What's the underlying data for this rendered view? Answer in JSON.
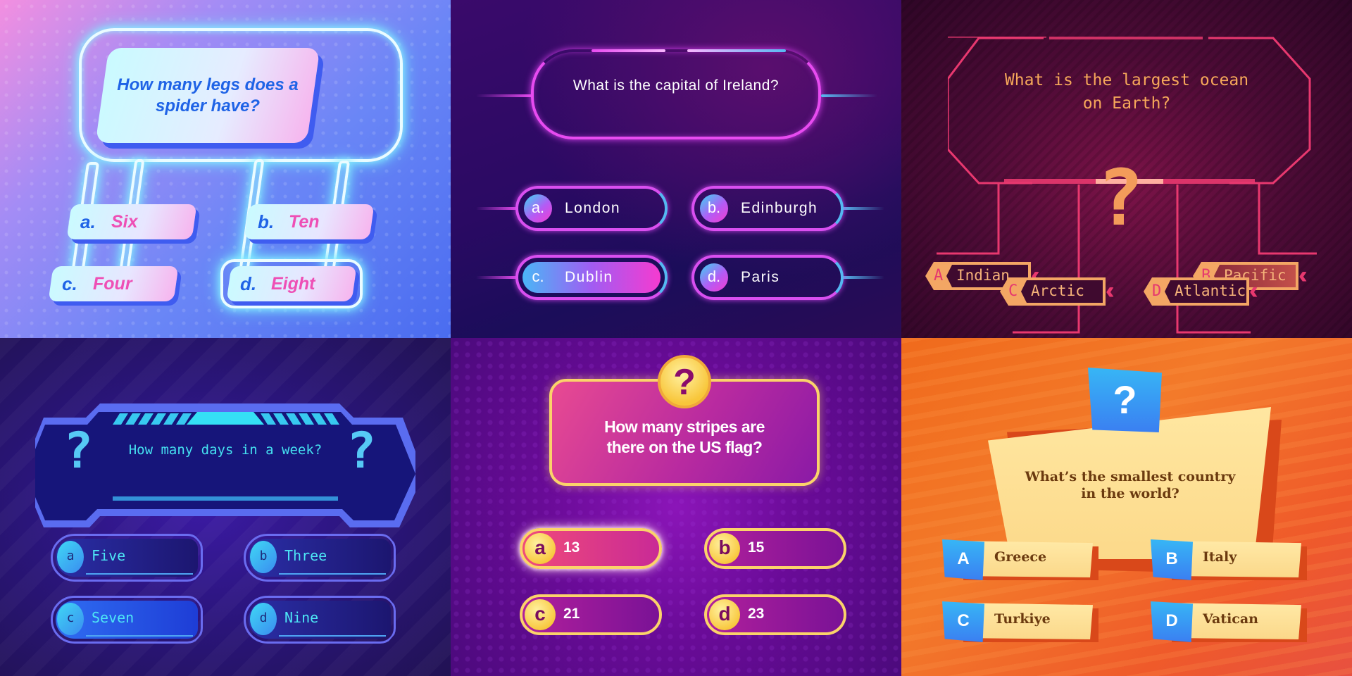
{
  "panels": [
    {
      "id": "spider",
      "question": "How many legs does a spider have?",
      "answers": [
        {
          "letter": "a.",
          "text": "Six"
        },
        {
          "letter": "b.",
          "text": "Ten"
        },
        {
          "letter": "c.",
          "text": "Four"
        },
        {
          "letter": "d.",
          "text": "Eight",
          "selected": true
        }
      ],
      "colors": {
        "question_text": "#1f63e6",
        "answer_text": "#ee4fb5",
        "neon": "#8ff3ff"
      }
    },
    {
      "id": "ireland",
      "question": "What is the capital of Ireland?",
      "answers": [
        {
          "letter": "a.",
          "text": "London"
        },
        {
          "letter": "b.",
          "text": "Edinburgh"
        },
        {
          "letter": "c.",
          "text": "Dublin",
          "selected": true
        },
        {
          "letter": "d.",
          "text": "Paris"
        }
      ],
      "colors": {
        "neon_pink": "#e74bf0",
        "neon_blue": "#58b9f2"
      }
    },
    {
      "id": "ocean",
      "question_line1": "What is the largest ocean",
      "question_line2": "on Earth?",
      "center_icon": "?",
      "answers": [
        {
          "letter": "A",
          "text": "Indian"
        },
        {
          "letter": "B",
          "text": "Pacific",
          "selected": true
        },
        {
          "letter": "C",
          "text": "Arctic"
        },
        {
          "letter": "D",
          "text": "Atlantic"
        }
      ],
      "colors": {
        "text": "#f6a85a",
        "accent": "#e5386f"
      }
    },
    {
      "id": "week",
      "question": "How many days in a week?",
      "left_icon": "?",
      "right_icon": "?",
      "answers": [
        {
          "letter": "a",
          "text": "Five"
        },
        {
          "letter": "b",
          "text": "Three"
        },
        {
          "letter": "c",
          "text": "Seven",
          "selected": true
        },
        {
          "letter": "d",
          "text": "Nine"
        }
      ],
      "colors": {
        "text": "#45e0f0",
        "frame": "#6a6cf0"
      }
    },
    {
      "id": "flag",
      "question_line1": "How many stripes are",
      "question_line2": "there on the US flag?",
      "icon": "?",
      "answers": [
        {
          "letter": "a",
          "text": "13",
          "selected": true
        },
        {
          "letter": "b",
          "text": "15"
        },
        {
          "letter": "c",
          "text": "21"
        },
        {
          "letter": "d",
          "text": "23"
        }
      ],
      "colors": {
        "gold": "#fbd36a",
        "pink": "#e84a92"
      }
    },
    {
      "id": "country",
      "question_line1": "What’s the smallest country",
      "question_line2": "in the world?",
      "icon": "?",
      "answers": [
        {
          "letter": "A",
          "text": "Greece"
        },
        {
          "letter": "B",
          "text": "Italy"
        },
        {
          "letter": "C",
          "text": "Turkiye"
        },
        {
          "letter": "D",
          "text": "Vatican"
        }
      ],
      "colors": {
        "card": "#ffe7a1",
        "badge": "#37b6f5",
        "text": "#6b3a0f"
      }
    }
  ]
}
